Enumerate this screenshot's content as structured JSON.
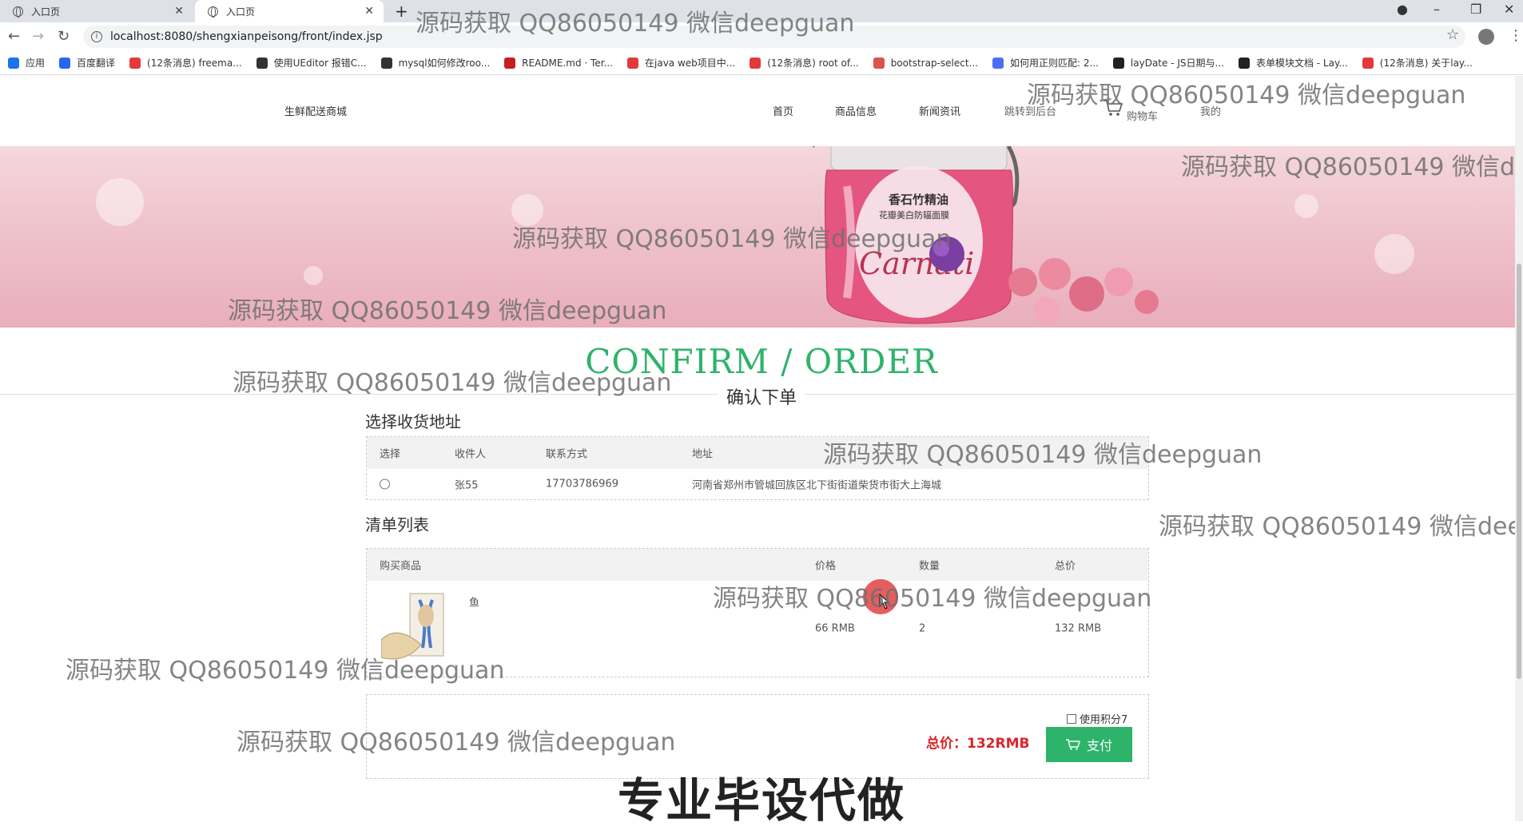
{
  "browser": {
    "tabs": [
      {
        "label": "入口页"
      },
      {
        "label": "入口页"
      }
    ],
    "url": "localhost:8080/shengxianpeisong/front/index.jsp",
    "bookmarks": [
      {
        "label": "应用",
        "color": "#1a73e8"
      },
      {
        "label": "百度翻译",
        "color": "#2468f2"
      },
      {
        "label": "(12条消息) freema...",
        "color": "#e4393c"
      },
      {
        "label": "使用UEditor 报错C...",
        "color": "#333333"
      },
      {
        "label": "mysql如何修改roo...",
        "color": "#333333"
      },
      {
        "label": "README.md · Ter...",
        "color": "#c71d23"
      },
      {
        "label": "在java web项目中...",
        "color": "#e4393c"
      },
      {
        "label": "(12条消息) root of...",
        "color": "#e4393c"
      },
      {
        "label": "bootstrap-select...",
        "color": "#d9534f"
      },
      {
        "label": "如何用正则匹配: 2...",
        "color": "#4e6ef2"
      },
      {
        "label": "layDate - JS日期与...",
        "color": "#222222"
      },
      {
        "label": "表单模块文档 - Lay...",
        "color": "#222222"
      },
      {
        "label": "(12条消息) 关于lay...",
        "color": "#e4393c"
      }
    ]
  },
  "site": {
    "brand": "生鲜配送商城",
    "nav": [
      {
        "label": "首页"
      },
      {
        "label": "商品信息"
      },
      {
        "label": "新闻资讯"
      },
      {
        "label": "跳转到后台"
      },
      {
        "label": "购物车"
      },
      {
        "label": "我的"
      }
    ]
  },
  "banner": {
    "jar_text1": "香石竹精油",
    "jar_text2": "花瓣美白防辐面膜",
    "jar_brand": "Carnati"
  },
  "page": {
    "title_en": "CONFIRM / ORDER",
    "title_cn": "确认下单"
  },
  "address": {
    "heading": "选择收货地址",
    "headers": [
      "选择",
      "收件人",
      "联系方式",
      "地址"
    ],
    "rows": [
      {
        "name": "张55",
        "phone": "17703786969",
        "address": "河南省郑州市管城回族区北下街街道柴货市街大上海城"
      }
    ]
  },
  "cart": {
    "heading": "清单列表",
    "headers": [
      "购买商品",
      "价格",
      "数量",
      "总价"
    ],
    "items": [
      {
        "name": "鱼",
        "price": "66 RMB",
        "qty": "2",
        "total": "132 RMB"
      }
    ]
  },
  "payment": {
    "points_label": "使用积分7",
    "total_label": "总价：132RMB",
    "pay_label": "支付",
    "accent": "#2eb36b",
    "total_color": "#d9262b"
  },
  "overlay": {
    "watermark": "源码获取 QQ86050149 微信deepguan",
    "promo": "专业毕设代做"
  }
}
